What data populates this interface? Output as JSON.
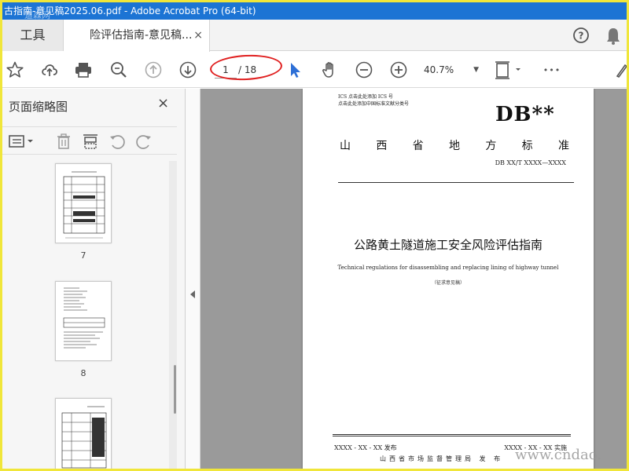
{
  "window": {
    "title": "古指南-意见稿2025.06.pdf - Adobe Acrobat Pro (64-bit)",
    "watermark_top": "道森网",
    "watermark_bottom": "www.cndao."
  },
  "tabs": {
    "tools_label": "工具",
    "doc_tab_label": "险评估指南-意见稿...",
    "close_symbol": "×"
  },
  "toolbar": {
    "current_page": "1",
    "page_total": "/ 18",
    "zoom_value": "40.7%",
    "more_symbol": "•••"
  },
  "thumbnails": {
    "panel_title": "页面缩略图",
    "items": [
      {
        "label": "7"
      },
      {
        "label": "8"
      }
    ]
  },
  "document": {
    "ics_line1": "ICS  点击此处添加 ICS 号",
    "ics_line2": "点击此处添加中国标准文献分类号",
    "db_code": "DB**",
    "province_chars": [
      "山",
      "西",
      "省",
      "地",
      "方",
      "标",
      "准"
    ],
    "standard_no": "DB XX/T  XXXX—XXXX",
    "title": "公路黄土隧道施工安全风险评估指南",
    "subtitle_en": "Technical regulations for disassembling and replacing lining of highway tunnel",
    "note": "（征求意见稿）",
    "issue_date": "XXXX - XX - XX 发布",
    "impl_date": "XXXX - XX - XX 实施",
    "authority": "山西省市场监督管理局   发 布"
  },
  "colors": {
    "titlebar": "#1c74d4",
    "accent_select": "#2d6fd6",
    "highlight_circle": "#e02020",
    "frame_border": "#f0e63a"
  }
}
